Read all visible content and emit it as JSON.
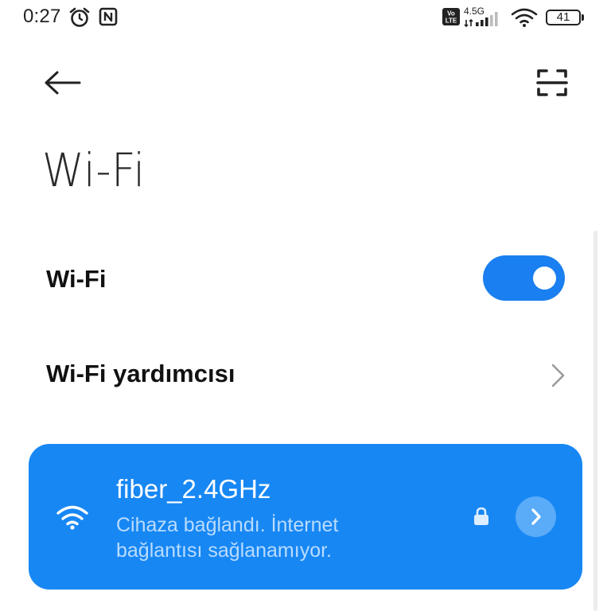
{
  "status_bar": {
    "time": "0:27",
    "network_type": "4.5G",
    "volte": "Vo LTE",
    "battery_level": "41",
    "icons": [
      "alarm-icon",
      "nfc-icon",
      "volte-icon",
      "cell-signal-icon",
      "wifi-signal-icon",
      "battery-icon"
    ]
  },
  "toolbar": {
    "back_icon": "arrow-left-icon",
    "scan_icon": "qr-scan-icon"
  },
  "page": {
    "title": "Wi-Fi"
  },
  "settings": {
    "wifi_toggle": {
      "label": "Wi-Fi",
      "enabled": true
    },
    "assistant": {
      "label": "Wi-Fi yardımcısı",
      "icon": "chevron-right-icon"
    }
  },
  "connected_network": {
    "ssid": "fiber_2.4GHz",
    "status_line1": "Cihaza bağlandı. İnternet",
    "status_line2": "bağlantısı sağlanamıyor.",
    "secured": true,
    "icons": [
      "wifi-icon",
      "lock-icon",
      "chevron-right-icon"
    ]
  },
  "colors": {
    "accent": "#1a7ff0",
    "card_background": "#1787f4",
    "card_secondary_text": "#b9dcff",
    "detail_button": "#5aabf8"
  }
}
